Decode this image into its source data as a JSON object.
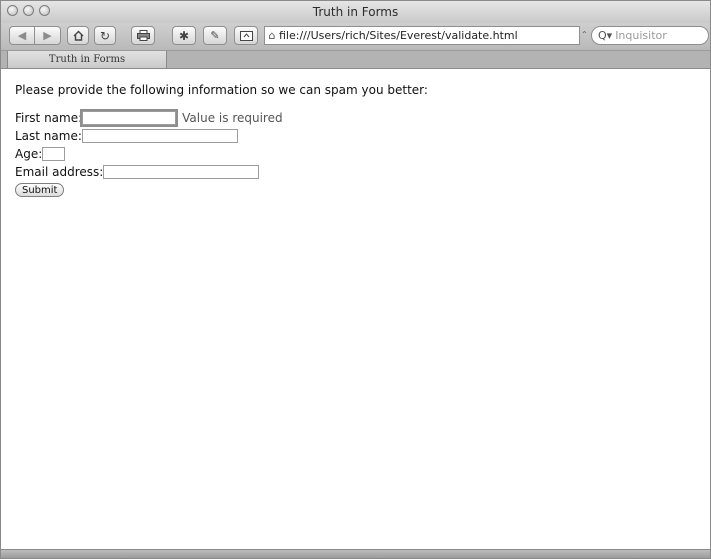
{
  "window": {
    "title": "Truth in Forms"
  },
  "toolbar": {
    "back_icon": "back-arrow-icon",
    "forward_icon": "forward-arrow-icon",
    "home_icon": "home-icon",
    "reload_icon": "reload-icon",
    "print_icon": "print-icon",
    "settings_icon": "gear-icon",
    "edit_icon": "edit-icon",
    "tool_icon": "window-tool-icon",
    "url": "file:///Users/rich/Sites/Everest/validate.html",
    "search_placeholder": "Inquisitor"
  },
  "tabs": [
    {
      "label": "Truth in Forms",
      "active": true
    }
  ],
  "page": {
    "intro": "Please provide the following information so we can spam you better:",
    "fields": {
      "first_name": {
        "label": "First name:",
        "value": "",
        "error": "Value is required"
      },
      "last_name": {
        "label": "Last name:",
        "value": ""
      },
      "age": {
        "label": "Age:",
        "value": ""
      },
      "email": {
        "label": "Email address:",
        "value": ""
      }
    },
    "submit_label": "Submit"
  }
}
